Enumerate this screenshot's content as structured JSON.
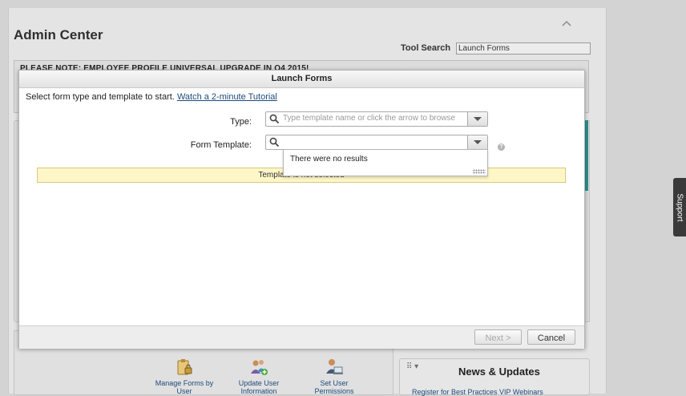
{
  "page": {
    "title": "Admin Center",
    "tool_search_label": "Tool Search",
    "tool_search_value": "Launch Forms",
    "notice": "PLEASE NOTE: EMPLOYEE PROFILE UNIVERSAL UPGRADE IN Q4 2015!"
  },
  "quick_actions": [
    {
      "label": "Manage Forms by User",
      "icon": "clipboard-lock-icon"
    },
    {
      "label": "Update User Information",
      "icon": "users-add-icon"
    },
    {
      "label": "Set User Permissions",
      "icon": "user-computer-icon"
    }
  ],
  "news": {
    "title": "News & Updates",
    "link": "Register for Best Practices VIP Webinars"
  },
  "support_tab": "Support",
  "modal": {
    "title": "Launch Forms",
    "intro": "Select form type and template to start.",
    "tutorial_link": "Watch a 2-minute Tutorial",
    "type_label": "Type:",
    "type_placeholder": "Type template name or click the arrow to browse",
    "template_label": "Form Template:",
    "template_value": "",
    "dropdown_message": "There were no results",
    "status_message": "Template is not selected",
    "next_button": "Next >",
    "cancel_button": "Cancel"
  },
  "colors": {
    "link": "#1f4a7c",
    "status_bg": "#fdf6c7",
    "accent_teal": "#2d8f8f"
  }
}
